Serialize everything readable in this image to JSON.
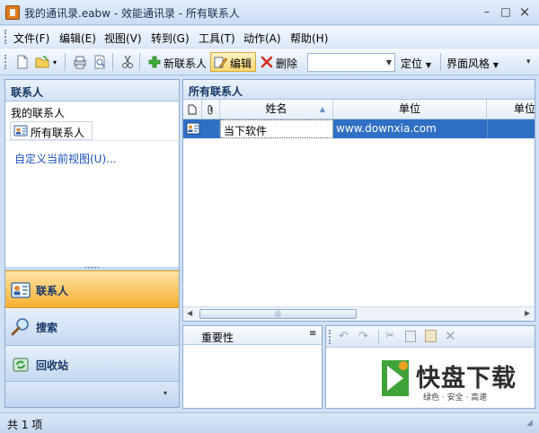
{
  "window": {
    "title": "我的通讯录.eabw - 效能通讯录 - 所有联系人",
    "minimize_glyph": "–",
    "restore_glyph": "□",
    "close_glyph": "×"
  },
  "menu": [
    "文件(F)",
    "编辑(E)",
    "视图(V)",
    "转到(G)",
    "工具(T)",
    "动作(A)",
    "帮助(H)"
  ],
  "toolbar": {
    "new_contact": "新联系人",
    "edit": "编辑",
    "delete": "删除",
    "locate": "定位",
    "theme": "界面风格",
    "view_value": ""
  },
  "left_panel": {
    "header": "联系人",
    "section": "我的联系人",
    "all_contacts": "所有联系人",
    "custom_view_link": "自定义当前视图(U)...",
    "nav": [
      {
        "label": "联系人",
        "icon": "contact-card-icon",
        "active": true
      },
      {
        "label": "搜索",
        "icon": "magnifier-icon",
        "active": false
      },
      {
        "label": "回收站",
        "icon": "recycle-icon",
        "active": false
      }
    ]
  },
  "right_panel": {
    "header": "所有联系人",
    "columns": [
      "姓名",
      "单位",
      "单位"
    ],
    "rows": [
      {
        "name": "当下软件",
        "company": "www.downxia.com"
      }
    ]
  },
  "detail": {
    "importance_label": "重要性"
  },
  "status": {
    "count_text": "共 1 项"
  },
  "watermark": {
    "brand": "快盘下载",
    "tagline": "绿色 · 安全 · 高速"
  },
  "colors": {
    "accent_orange": "#f8b030",
    "selection_blue": "#2f6fc4",
    "header_text": "#153766"
  }
}
